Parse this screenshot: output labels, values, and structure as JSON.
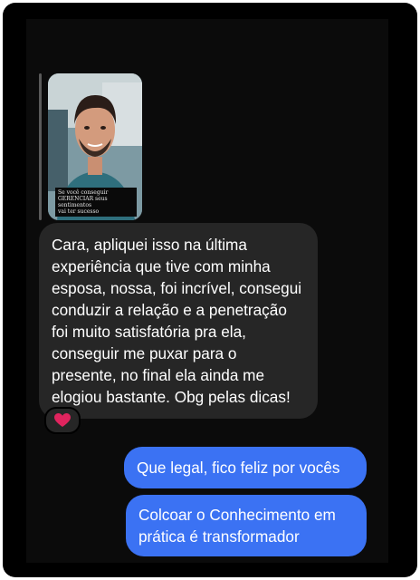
{
  "story_reply": {
    "caption": "Se você conseguir\nGERENCIAR seus sentimentos\nvai ter sucesso"
  },
  "messages": {
    "received": "Cara, apliquei isso na última experiência que tive com minha esposa, nossa, foi incrível, consegui conduzir a relação e a penetração foi muito satisfatória pra ela, conseguir me puxar para o presente, no final ela ainda me elogiou bastante. Obg pelas dicas!",
    "reaction_icon": "heart-icon",
    "sent": [
      "Que legal, fico feliz por vocês",
      "Colcoar o Conhecimento em prática é transformador"
    ]
  },
  "colors": {
    "sent_bubble": "#3b72f3",
    "received_bubble": "#262626",
    "background": "#000000",
    "reaction": "#e0245e"
  }
}
